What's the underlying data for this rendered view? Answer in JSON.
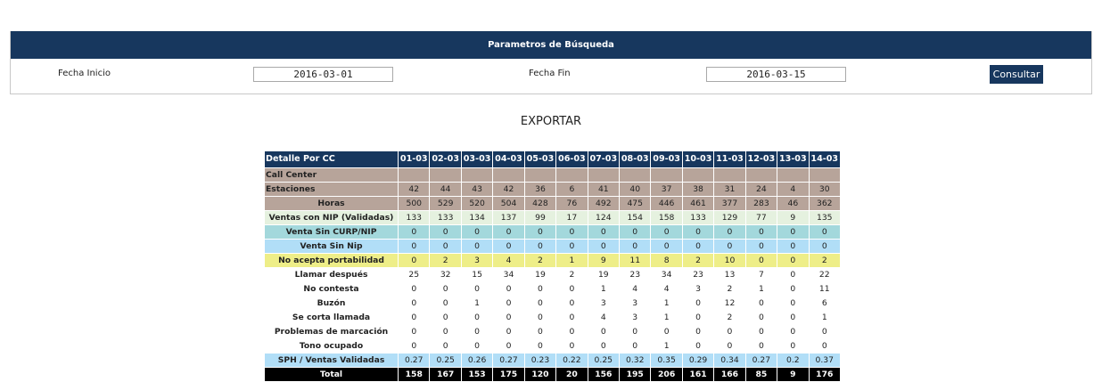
{
  "search": {
    "header": "Parametros de Búsqueda",
    "fecha_inicio_label": "Fecha Inicio",
    "fecha_inicio_value": "2016-03-01",
    "fecha_fin_label": "Fecha Fin",
    "fecha_fin_value": "2016-03-15",
    "consultar_label": "Consultar"
  },
  "export_label": "EXPORTAR",
  "table": {
    "header_label": "Detalle Por CC",
    "columns": [
      "01-03",
      "02-03",
      "03-03",
      "04-03",
      "05-03",
      "06-03",
      "07-03",
      "08-03",
      "09-03",
      "10-03",
      "11-03",
      "12-03",
      "13-03",
      "14-03"
    ],
    "rows": [
      {
        "label": "Call Center",
        "style": "tan",
        "align": "left",
        "values": [
          "",
          "",
          "",
          "",
          "",
          "",
          "",
          "",
          "",
          "",
          "",
          "",
          "",
          ""
        ]
      },
      {
        "label": "Estaciones",
        "style": "tan",
        "align": "left",
        "values": [
          "42",
          "44",
          "43",
          "42",
          "36",
          "6",
          "41",
          "40",
          "37",
          "38",
          "31",
          "24",
          "4",
          "30"
        ]
      },
      {
        "label": "Horas",
        "style": "tan",
        "align": "center",
        "values": [
          "500",
          "529",
          "520",
          "504",
          "428",
          "76",
          "492",
          "475",
          "446",
          "461",
          "377",
          "283",
          "46",
          "362"
        ]
      },
      {
        "label": "Ventas con NIP (Validadas)",
        "style": "lightgreen",
        "align": "center",
        "values": [
          "133",
          "133",
          "134",
          "137",
          "99",
          "17",
          "124",
          "154",
          "158",
          "133",
          "129",
          "77",
          "9",
          "135"
        ]
      },
      {
        "label": "Venta Sin CURP/NIP",
        "style": "teal",
        "align": "center",
        "values": [
          "0",
          "0",
          "0",
          "0",
          "0",
          "0",
          "0",
          "0",
          "0",
          "0",
          "0",
          "0",
          "0",
          "0"
        ]
      },
      {
        "label": "Venta Sin Nip",
        "style": "blue",
        "align": "center",
        "values": [
          "0",
          "0",
          "0",
          "0",
          "0",
          "0",
          "0",
          "0",
          "0",
          "0",
          "0",
          "0",
          "0",
          "0"
        ]
      },
      {
        "label": "No acepta portabilidad",
        "style": "yellow",
        "align": "center",
        "values": [
          "0",
          "2",
          "3",
          "4",
          "2",
          "1",
          "9",
          "11",
          "8",
          "2",
          "10",
          "0",
          "0",
          "2"
        ]
      },
      {
        "label": "Llamar después",
        "style": "white",
        "align": "center",
        "values": [
          "25",
          "32",
          "15",
          "34",
          "19",
          "2",
          "19",
          "23",
          "34",
          "23",
          "13",
          "7",
          "0",
          "22"
        ]
      },
      {
        "label": "No contesta",
        "style": "white",
        "align": "center",
        "values": [
          "0",
          "0",
          "0",
          "0",
          "0",
          "0",
          "1",
          "4",
          "4",
          "3",
          "2",
          "1",
          "0",
          "11"
        ]
      },
      {
        "label": "Buzón",
        "style": "white",
        "align": "center",
        "values": [
          "0",
          "0",
          "1",
          "0",
          "0",
          "0",
          "3",
          "3",
          "1",
          "0",
          "12",
          "0",
          "0",
          "6"
        ]
      },
      {
        "label": "Se corta llamada",
        "style": "white",
        "align": "center",
        "values": [
          "0",
          "0",
          "0",
          "0",
          "0",
          "0",
          "4",
          "3",
          "1",
          "0",
          "2",
          "0",
          "0",
          "1"
        ]
      },
      {
        "label": "Problemas de marcación",
        "style": "white",
        "align": "center",
        "values": [
          "0",
          "0",
          "0",
          "0",
          "0",
          "0",
          "0",
          "0",
          "0",
          "0",
          "0",
          "0",
          "0",
          "0"
        ]
      },
      {
        "label": "Tono ocupado",
        "style": "white",
        "align": "center",
        "values": [
          "0",
          "0",
          "0",
          "0",
          "0",
          "0",
          "0",
          "0",
          "1",
          "0",
          "0",
          "0",
          "0",
          "0"
        ]
      },
      {
        "label": "SPH / Ventas Validadas",
        "style": "blue",
        "align": "center",
        "values": [
          "0.27",
          "0.25",
          "0.26",
          "0.27",
          "0.23",
          "0.22",
          "0.25",
          "0.32",
          "0.35",
          "0.29",
          "0.34",
          "0.27",
          "0.2",
          "0.37"
        ]
      },
      {
        "label": "Total",
        "style": "total",
        "align": "center",
        "values": [
          "158",
          "167",
          "153",
          "175",
          "120",
          "20",
          "156",
          "195",
          "206",
          "161",
          "166",
          "85",
          "9",
          "176"
        ]
      }
    ]
  }
}
